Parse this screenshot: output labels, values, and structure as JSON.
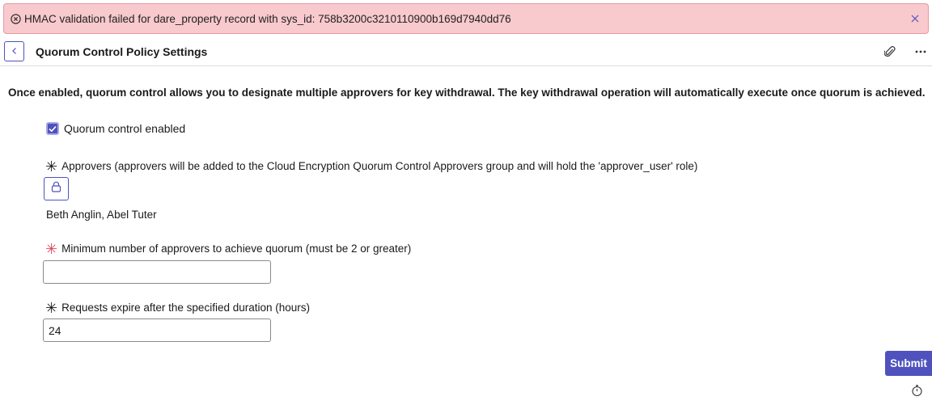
{
  "error_banner": {
    "message": "HMAC validation failed for dare_property record with sys_id: 758b3200c3210110900b169d7940dd76",
    "icon": "error-circle-icon",
    "close_icon": "close-icon"
  },
  "header": {
    "title": "Quorum Control Policy Settings",
    "back_icon": "chevron-left-icon",
    "attach_icon": "paperclip-icon",
    "more_icon": "more-horizontal-icon"
  },
  "intro_text": "Once enabled, quorum control allows you to designate multiple approvers for key withdrawal. The key withdrawal operation will automatically execute once quorum is achieved.",
  "quorum_checkbox": {
    "label": "Quorum control enabled",
    "checked": true
  },
  "approvers": {
    "label": "Approvers (approvers will be added to the Cloud Encryption Quorum Control Approvers group and will hold the 'approver_user' role)",
    "lock_icon": "lock-icon",
    "value": "Beth Anglin, Abel Tuter"
  },
  "min_approvers": {
    "label": "Minimum number of approvers to achieve quorum (must be 2 or greater)",
    "value": ""
  },
  "expiry": {
    "label": "Requests expire after the specified duration (hours)",
    "value": "24"
  },
  "submit_label": "Submit",
  "colors": {
    "accent": "#4f52bd",
    "error_bg": "#f8c9cd",
    "required": "#e0495a"
  }
}
